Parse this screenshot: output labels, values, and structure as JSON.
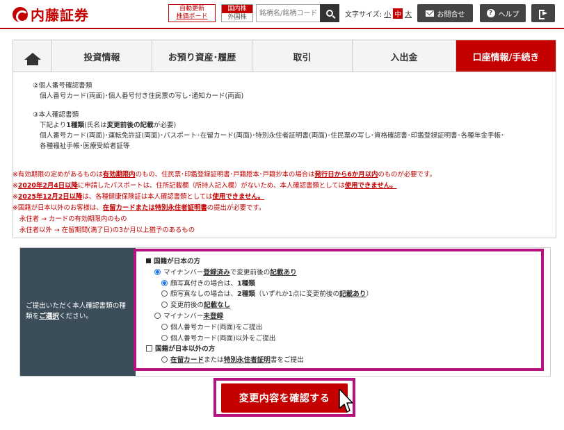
{
  "header": {
    "logo_text": "内藤証券",
    "auto_refresh_line1": "自動更新",
    "auto_refresh_line2": "株価ボード",
    "market_domestic": "国内株",
    "market_foreign": "外国株",
    "search_placeholder": "銘柄名/銘柄コード",
    "fontsize_label": "文字サイズ:",
    "fontsize_small": "小",
    "fontsize_medium": "中",
    "fontsize_large": "大",
    "contact_label": "お問合せ",
    "help_label": "ヘルプ"
  },
  "nav": {
    "tabs": [
      {
        "label": "投資情報"
      },
      {
        "label": "お預り資産･履歴"
      },
      {
        "label": "取引"
      },
      {
        "label": "入出金"
      },
      {
        "label": "口座情報/手続き"
      }
    ]
  },
  "content": {
    "sec2_title": "②個人番号確認書類",
    "sec2_body": "個人番号カード(両面)･個人番号付き住民票の写し･通知カード(両面)",
    "sec3_title": "③本人確認書類",
    "sec3_line1_a": "下記より",
    "sec3_line1_b": "1種類",
    "sec3_line1_c": "(氏名は",
    "sec3_line1_d": "変更前後の記載",
    "sec3_line1_e": "が必要)",
    "sec3_line2": "個人番号カード(両面)･運転免許証(両面)･パスポート･在留カード(両面)･特別永住者証明書(両面)･住民票の写し･資格確認書･印鑑登録証明書･各種年金手帳･",
    "sec3_line3": "各種福祉手帳･医療受給者証等",
    "note1_a": "※有効期限の定めがあるものは",
    "note1_b": "有効期限内",
    "note1_c": "のもの、住民票･印鑑登録証明書･戸籍謄本･戸籍抄本の場合は",
    "note1_d": "発行日から6か月以内",
    "note1_e": "のものが必要です。",
    "note2_a": "※",
    "note2_b": "2020年2月4日以降",
    "note2_c": "に申請したパスポートは、住所記載欄（所持人記入欄）がないため、本人確認書類としては",
    "note2_d": "使用できません。",
    "note3_a": "※",
    "note3_b": "2025年12月2日以降",
    "note3_c": "は、各種健康保険証は本人確認書類としては",
    "note3_d": "使用できません。",
    "note4_a": "※国籍が日本以外のお客様は、",
    "note4_b": "在留カードまたは特別永住者証明書",
    "note4_c": "の提出が必要です。",
    "note5": "永住者 → カードの有効期限内のもの",
    "note6": "永住者以外 → 在留期間(満了日)の3か月以上猶予のあるもの"
  },
  "form": {
    "label_a": "ご提出いただく本人確認書類の種類を",
    "label_b": "ご選択",
    "label_c": "ください。",
    "jp_head": "国籍が日本の方",
    "mn_reg_a": "マイナンバー",
    "mn_reg_b": "登録済み",
    "mn_reg_c": "で変更前後の",
    "mn_reg_d": "記載あり",
    "photo_a": "顔写真付きの場合は、",
    "photo_b": "1種類",
    "nophoto_a": "顔写真なしの場合は、",
    "nophoto_b": "2種類",
    "nophoto_c": "（いずれか1点に変更前後の",
    "nophoto_d": "記載あり",
    "nophoto_e": "）",
    "nochange_a": "変更前後の",
    "nochange_b": "記載なし",
    "mn_unreg_a": "マイナンバー",
    "mn_unreg_b": "未登録",
    "card_submit": "個人番号カード(両面)をご提出",
    "card_other": "個人番号カード(両面)以外をご提出",
    "foreign_head": "国籍が日本以外の方",
    "foreign_opt_a": "在留カード",
    "foreign_opt_b": "または",
    "foreign_opt_c": "特別永住者証明",
    "foreign_opt_d": "書をご提出"
  },
  "confirm_label": "変更内容を確認する"
}
